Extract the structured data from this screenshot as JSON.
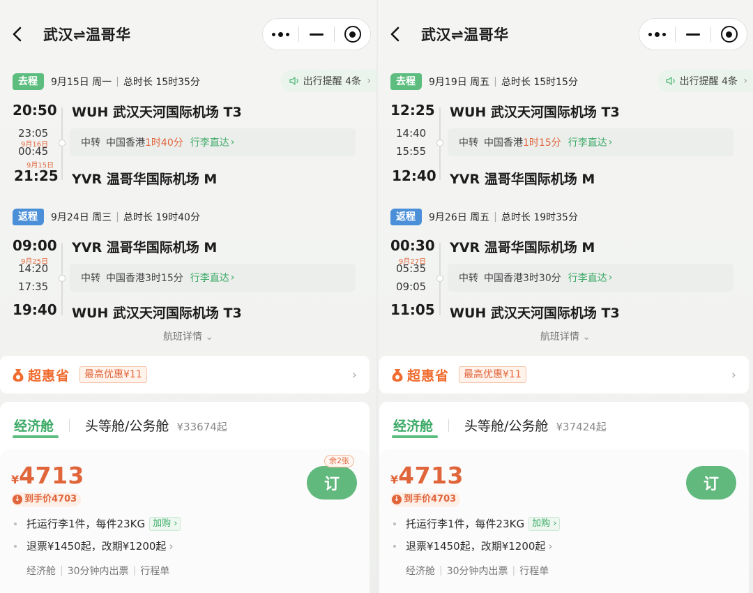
{
  "panels": [
    {
      "route_title": "武汉⇌温哥华",
      "outbound": {
        "tag": "去程",
        "date": "9月15日 周一",
        "duration": "总时长 15时35分",
        "reminder": "出行提醒 4条",
        "dep_time": "20:50",
        "dep_airport": "WUH 武汉天河国际机场 T3",
        "stop_arr_time": "23:05",
        "stop_day_note": "9月16日",
        "stop_dep_time": "00:45",
        "arr_day_note": "9月15日",
        "transfer_label": "中转",
        "transfer_city": "中国香港",
        "transfer_duration": "1时40分",
        "baggage": "行李直达",
        "arr_time": "21:25",
        "arr_airport": "YVR 温哥华国际机场 M"
      },
      "return": {
        "tag": "返程",
        "date": "9月24日 周三",
        "duration": "总时长 19时40分",
        "dep_time": "09:00",
        "dep_airport": "YVR 温哥华国际机场 M",
        "stop_day_note": "9月25日",
        "stop_arr_time": "14:20",
        "stop_dep_time": "17:35",
        "transfer_label": "中转",
        "transfer_city": "中国香港",
        "transfer_duration": "3时15分",
        "baggage": "行李直达",
        "arr_time": "19:40",
        "arr_airport": "WUH 武汉天河国际机场 T3"
      },
      "flight_detail": "航班详情",
      "promo": {
        "name": "超惠省",
        "badge": "最高优惠¥11"
      },
      "cabin": {
        "economy": "经济舱",
        "business": "头等舱/公务舱",
        "business_price": "¥33674起"
      },
      "offer": {
        "currency": "¥",
        "price": "4713",
        "final_price": "到手价4703",
        "seats_left": "余2张",
        "book": "订",
        "baggage": "托运行李1件，每件23KG",
        "baggage_add": "加购",
        "refund": "退票¥1450起，改期¥1200起",
        "meta": [
          "经济舱",
          "30分钟内出票",
          "行程单"
        ]
      }
    },
    {
      "route_title": "武汉⇌温哥华",
      "outbound": {
        "tag": "去程",
        "date": "9月19日 周五",
        "duration": "总时长 15时15分",
        "reminder": "出行提醒 4条",
        "dep_time": "12:25",
        "dep_airport": "WUH 武汉天河国际机场 T3",
        "stop_arr_time": "14:40",
        "stop_day_note": "",
        "stop_dep_time": "15:55",
        "arr_day_note": "",
        "transfer_label": "中转",
        "transfer_city": "中国香港",
        "transfer_duration": "1时15分",
        "baggage": "行李直达",
        "arr_time": "12:40",
        "arr_airport": "YVR 温哥华国际机场 M"
      },
      "return": {
        "tag": "返程",
        "date": "9月26日 周五",
        "duration": "总时长 19时35分",
        "dep_time": "00:30",
        "dep_airport": "YVR 温哥华国际机场 M",
        "stop_day_note": "9月27日",
        "stop_arr_time": "05:35",
        "stop_dep_time": "09:05",
        "transfer_label": "中转",
        "transfer_city": "中国香港",
        "transfer_duration": "3时30分",
        "baggage": "行李直达",
        "arr_time": "11:05",
        "arr_airport": "WUH 武汉天河国际机场 T3"
      },
      "flight_detail": "航班详情",
      "promo": {
        "name": "超惠省",
        "badge": "最高优惠¥11"
      },
      "cabin": {
        "economy": "经济舱",
        "business": "头等舱/公务舱",
        "business_price": "¥37424起"
      },
      "offer": {
        "currency": "¥",
        "price": "4713",
        "final_price": "到手价4703",
        "seats_left": "",
        "book": "订",
        "baggage": "托运行李1件，每件23KG",
        "baggage_add": "加购",
        "refund": "退票¥1450起，改期¥1200起",
        "meta": [
          "经济舱",
          "30分钟内出票",
          "行程单"
        ]
      }
    }
  ]
}
